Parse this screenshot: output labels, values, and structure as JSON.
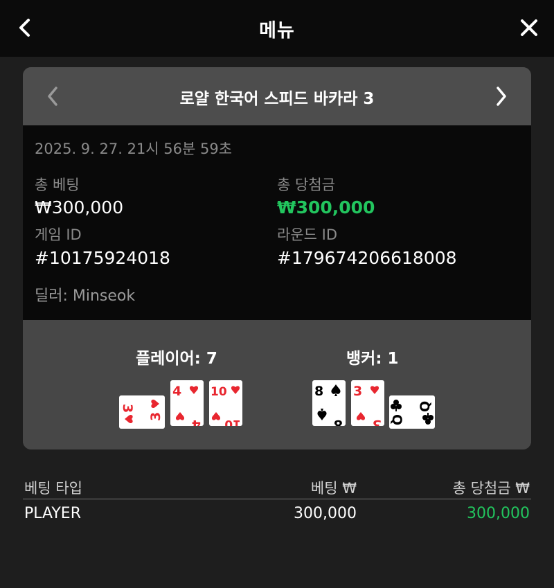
{
  "header": {
    "title": "메뉴"
  },
  "game": {
    "title": "로얄 한국어 스피드 바카라 3",
    "datetime": "2025. 9. 27. 21시 56분 59초",
    "total_bet_label": "총 베팅",
    "total_bet_value": "₩300,000",
    "total_win_label": "총 당첨금",
    "total_win_value": "₩300,000",
    "game_id_label": "게임 ID",
    "game_id_value": "#10175924018",
    "round_id_label": "라운드 ID",
    "round_id_value": "#179674206618008",
    "dealer": "딜러: Minseok"
  },
  "hands": {
    "player_label": "플레이어: 7",
    "banker_label": "뱅커: 1",
    "player_cards": [
      {
        "rank": "3",
        "suit": "hearts",
        "color": "#e8262f",
        "orientation": "sideways"
      },
      {
        "rank": "4",
        "suit": "hearts",
        "color": "#e8262f",
        "orientation": "upright"
      },
      {
        "rank": "10",
        "suit": "hearts",
        "color": "#e8262f",
        "orientation": "upright"
      }
    ],
    "banker_cards": [
      {
        "rank": "8",
        "suit": "spades",
        "color": "#000000",
        "orientation": "upright"
      },
      {
        "rank": "3",
        "suit": "hearts",
        "color": "#e8262f",
        "orientation": "upright"
      },
      {
        "rank": "Q",
        "suit": "clubs",
        "color": "#000000",
        "orientation": "sideways"
      }
    ]
  },
  "bets": {
    "col_type": "베팅 타입",
    "col_bet": "베팅 ₩",
    "col_win": "총 당첨금 ₩",
    "rows": [
      {
        "type": "PLAYER",
        "bet": "300,000",
        "win": "300,000"
      }
    ]
  },
  "colors": {
    "win_green": "#22c55e",
    "heart_red": "#e8262f"
  }
}
